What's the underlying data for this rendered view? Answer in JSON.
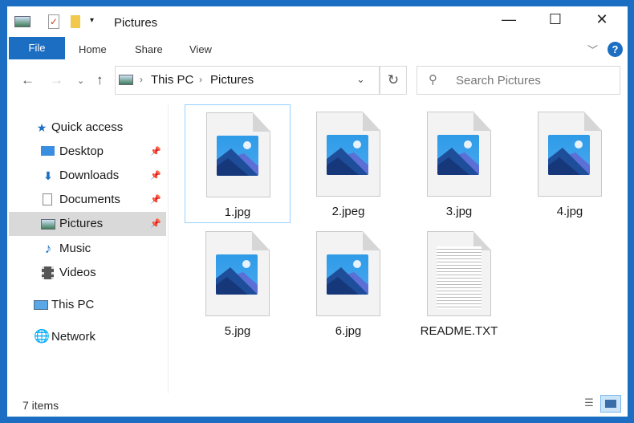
{
  "window": {
    "title": "Pictures",
    "controls": [
      "minimize",
      "maximize",
      "close"
    ]
  },
  "ribbon": {
    "tabs": [
      "File",
      "Home",
      "Share",
      "View"
    ],
    "help": "?"
  },
  "address": {
    "path": [
      "This PC",
      "Pictures"
    ]
  },
  "search": {
    "placeholder": "Search Pictures"
  },
  "sidebar": {
    "items": [
      {
        "label": "Quick access",
        "icon": "star-icon"
      },
      {
        "label": "Desktop",
        "icon": "desktop-icon",
        "pinned": true
      },
      {
        "label": "Downloads",
        "icon": "download-icon",
        "pinned": true
      },
      {
        "label": "Documents",
        "icon": "documents-icon",
        "pinned": true
      },
      {
        "label": "Pictures",
        "icon": "pictures-icon",
        "pinned": true,
        "selected": true
      },
      {
        "label": "Music",
        "icon": "music-icon"
      },
      {
        "label": "Videos",
        "icon": "videos-icon"
      },
      {
        "label": "This PC",
        "icon": "computer-icon"
      },
      {
        "label": "Network",
        "icon": "network-icon"
      }
    ]
  },
  "files": [
    {
      "name": "1.jpg",
      "type": "image",
      "selected": true
    },
    {
      "name": "2.jpeg",
      "type": "image"
    },
    {
      "name": "3.jpg",
      "type": "image"
    },
    {
      "name": "4.jpg",
      "type": "image"
    },
    {
      "name": "5.jpg",
      "type": "image"
    },
    {
      "name": "6.jpg",
      "type": "image"
    },
    {
      "name": "README.TXT",
      "type": "text"
    }
  ],
  "status": {
    "count": "7 items"
  },
  "colors": {
    "accent": "#1b6ec2"
  }
}
